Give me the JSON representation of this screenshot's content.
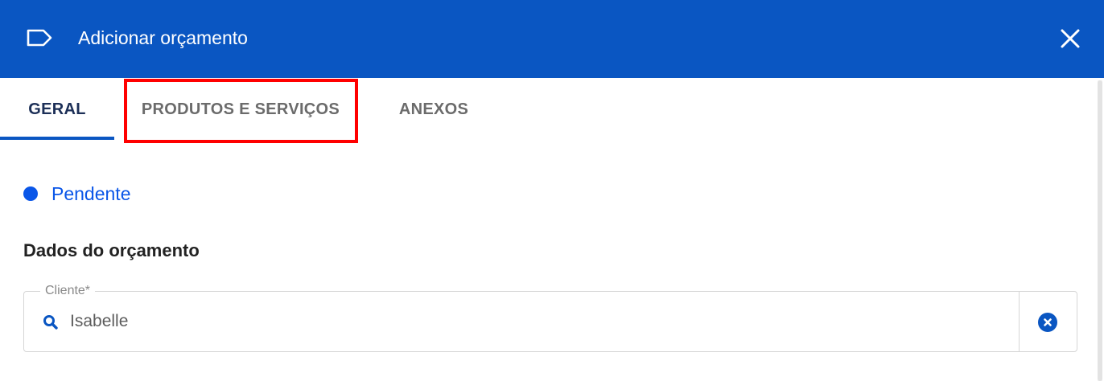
{
  "dialog": {
    "title": "Adicionar orçamento",
    "title_icon": "label-tag-icon",
    "close_icon": "close-icon",
    "header_color": "#0a56c2"
  },
  "tabs": [
    {
      "label": "GERAL",
      "active": true
    },
    {
      "label": "PRODUTOS E SERVIÇOS",
      "active": false,
      "highlighted": true
    },
    {
      "label": "ANEXOS",
      "active": false
    }
  ],
  "status": {
    "label": "Pendente",
    "color": "#0a56e8"
  },
  "section": {
    "title": "Dados do orçamento"
  },
  "client_field": {
    "label": "Cliente*",
    "value": "Isabelle",
    "search_icon": "search-icon",
    "clear_icon": "clear-circle-icon"
  },
  "colors": {
    "accent": "#0a56c2",
    "highlight": "#ff0000"
  }
}
